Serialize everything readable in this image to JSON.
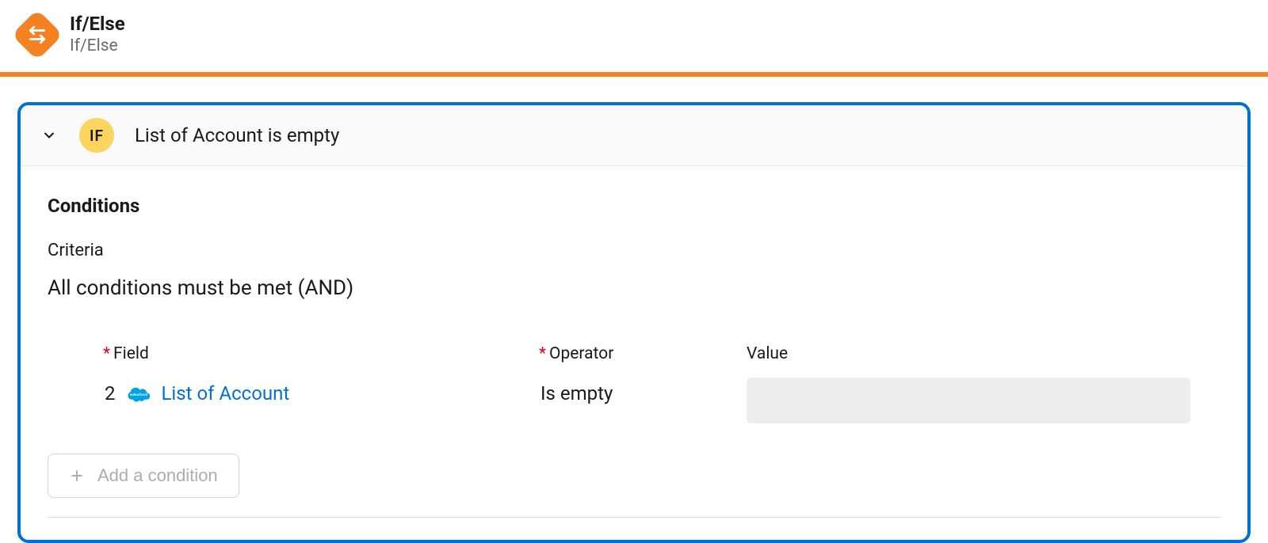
{
  "header": {
    "title": "If/Else",
    "subtitle": "If/Else"
  },
  "panel": {
    "badge": "IF",
    "title": "List of Account is empty"
  },
  "conditions": {
    "section_title": "Conditions",
    "criteria_label": "Criteria",
    "criteria_value": "All conditions must be met (AND)",
    "columns": {
      "field": "Field",
      "operator": "Operator",
      "value": "Value"
    },
    "rows": [
      {
        "step": "2",
        "field_label": "List of Account",
        "operator": "Is empty",
        "value": ""
      }
    ],
    "add_button": "Add a condition"
  }
}
